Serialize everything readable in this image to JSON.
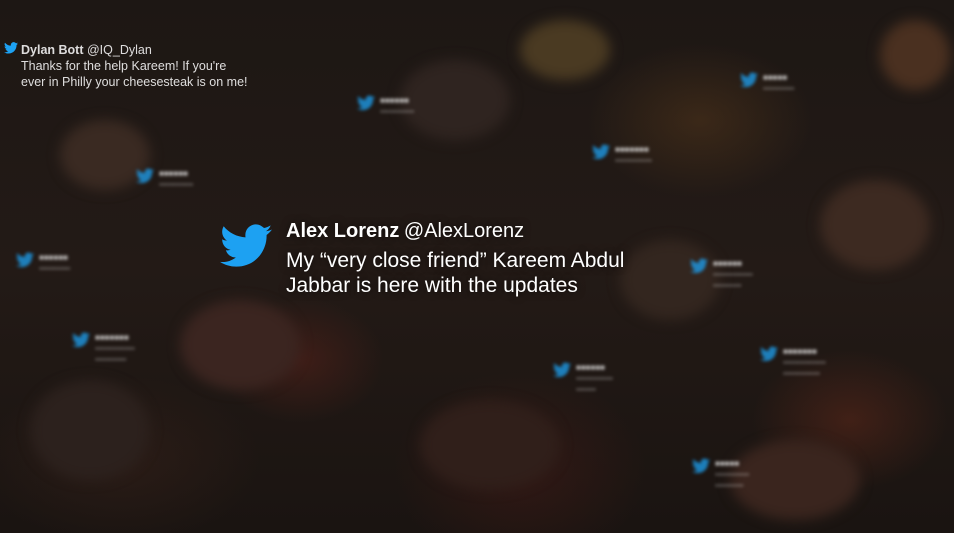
{
  "colors": {
    "twitter_blue": "#1DA1F2",
    "text": "#ffffff"
  },
  "icons": {
    "bird": "twitter-bird-icon"
  },
  "tweets": {
    "dylan": {
      "name": "Dylan Bott",
      "handle": "@IQ_Dylan",
      "line1": "Thanks for the help Kareem! If you're",
      "line2": "ever in Philly your cheesesteak is on me!"
    },
    "main": {
      "name": "Alex Lorenz",
      "handle": "@AlexLorenz",
      "line1": "My “very close friend” Kareem Abdul",
      "line2": "Jabbar is here with the updates"
    }
  }
}
